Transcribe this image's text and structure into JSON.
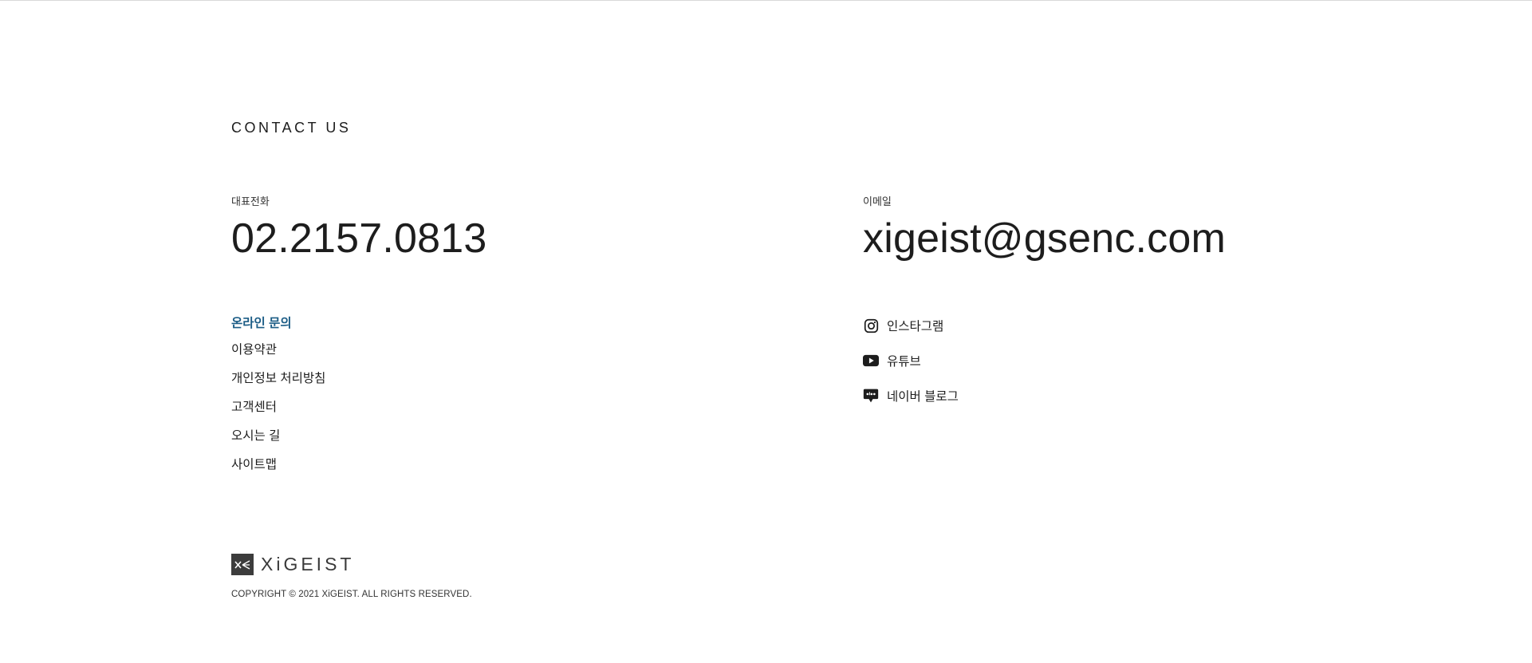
{
  "section": {
    "title": "CONTACT US"
  },
  "contact": {
    "phone_label": "대표전화",
    "phone_value": "02.2157.0813",
    "email_label": "이메일",
    "email_value": "xigeist@gsenc.com"
  },
  "links": [
    {
      "label": "온라인 문의",
      "active": true
    },
    {
      "label": "이용약관"
    },
    {
      "label": "개인정보 처리방침"
    },
    {
      "label": "고객센터"
    },
    {
      "label": "오시는 길"
    },
    {
      "label": "사이트맵"
    }
  ],
  "social": [
    {
      "label": "인스타그램",
      "icon": "instagram-icon"
    },
    {
      "label": "유튜브",
      "icon": "youtube-icon"
    },
    {
      "label": "네이버 블로그",
      "icon": "naver-blog-icon"
    }
  ],
  "brand": {
    "wordmark": "XiGEIST",
    "copyright": "COPYRIGHT © 2021 XiGEIST. ALL RIGHTS RESERVED."
  },
  "colors": {
    "accent": "#1c5d86",
    "text": "#1d1d1d",
    "logo": "#3c3c3c"
  }
}
